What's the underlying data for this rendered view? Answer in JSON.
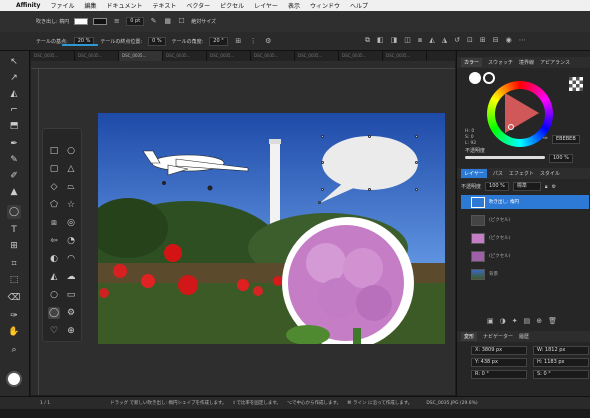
{
  "menubar": {
    "apple": "",
    "app": "Affinity",
    "items": [
      "ファイル",
      "編集",
      "ドキュメント",
      "テキスト",
      "ベクター",
      "ピクセル",
      "レイヤー",
      "表示",
      "ウィンドウ",
      "ヘルプ"
    ]
  },
  "context_toolbar": {
    "label1": "吹き出し: 楕円",
    "label2": "0 pt",
    "checkbox_label": "絶対サイズ",
    "tail_width_label": "テールの基点:",
    "tail_width_value": "20 %",
    "tail_pos_label": "テールの終点位置:",
    "tail_pos_value": "0 %",
    "tail_angle_label": "テールの角度:",
    "tail_angle_value": "20 °"
  },
  "doc_tabs": [
    "DSC_0035...",
    "DSC_0035...",
    "DSC_0035...",
    "DSC_0035...",
    "DSC_0035...",
    "DSC_0035...",
    "DSC_0035...",
    "DSC_0035...",
    "DSC_0035..."
  ],
  "right_panel": {
    "color_tabs": [
      "カラー",
      "スウォッチ",
      "境界線",
      "アピアランス"
    ],
    "hsl": {
      "h": "H: 0",
      "s": "S: 0",
      "l": "L: 92"
    },
    "hex": "EBEBEB",
    "opacity_label": "不透明度",
    "opacity_value": "100 %",
    "layer_tabs": [
      "レイヤー",
      "パス",
      "エフェクト",
      "スタイル"
    ],
    "blend_label": "不透明度",
    "blend_opacity": "100 %",
    "blend_mode": "標準",
    "layers": [
      {
        "name": "吹き出し: 楕円",
        "thumb": "bubble",
        "selected": true
      },
      {
        "name": "(ピクセル)",
        "thumb": "plane",
        "selected": false
      },
      {
        "name": "(ピクセル)",
        "thumb": "flower",
        "selected": false
      },
      {
        "name": "(ピクセル)",
        "thumb": "flower",
        "selected": false
      },
      {
        "name": "背景",
        "thumb": "photo",
        "selected": false
      }
    ],
    "transform_tabs": [
      "変形",
      "ナビゲーター",
      "履歴"
    ],
    "transform": {
      "x": "X: 3809 px",
      "y": "Y: 438 px",
      "w": "W: 1812 px",
      "h": "H: 1183 px",
      "r": "R: 0 °",
      "s": "S: 0 °"
    }
  },
  "status": {
    "page": "1 / 1",
    "hint": "ドラッグ で新しい吹き出し: 楕円シェイプを作成します。",
    "hint2": "⇧で比率を固定します。",
    "hint3": "⌥で中心から作成します。",
    "hint4": "⌘ ライン に沿って作成します。",
    "file": "DSC_0035.JPG (29.6%)"
  },
  "colors": {
    "accent": "#2d7ad6",
    "wheel_pointer": "#ebebeb"
  }
}
